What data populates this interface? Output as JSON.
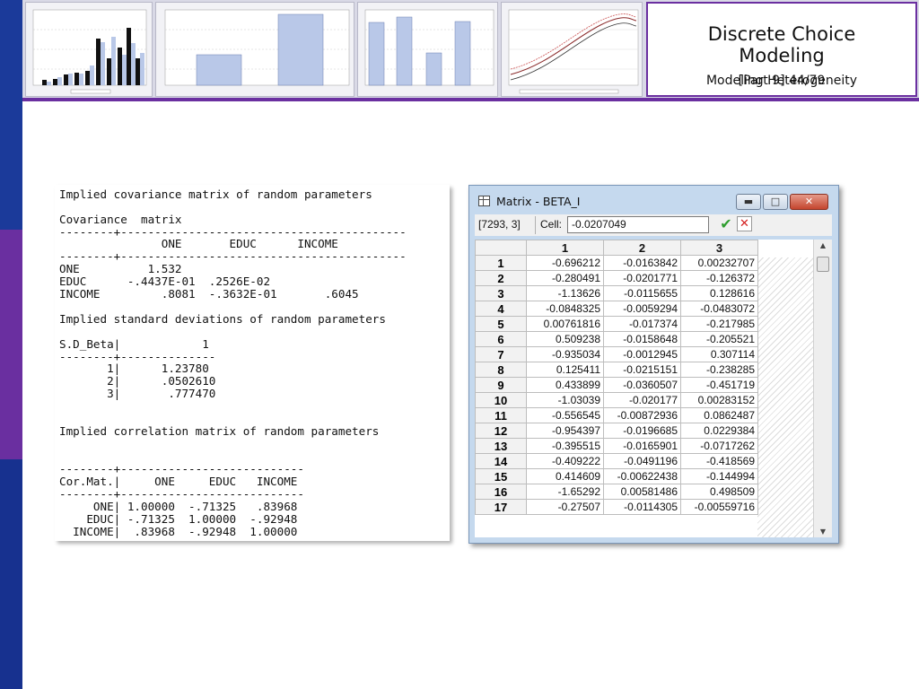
{
  "slide": {
    "title_line1": "Discrete Choice",
    "title_line2": "Modeling",
    "subtitle_left": "Modeling Heterogeneity",
    "subtitle_right": "[Part 9]    44/79"
  },
  "colors": {
    "sidebar_blue": "#1b3a9a",
    "sidebar_purple": "#6a2fa0",
    "header_bg": "#d9d9e6"
  },
  "output": {
    "heading1": "Implied covariance matrix of random parameters",
    "cov_label": "Covariance  matrix",
    "dash1": "--------+------------------------------------------",
    "cov_header": "               ONE       EDUC      INCOME",
    "dash2": "--------+------------------------------------------",
    "cov_row1": "ONE          1.532",
    "cov_row2": "EDUC      -.4437E-01  .2526E-02",
    "cov_row3": "INCOME         .8081  -.3632E-01       .6045",
    "heading2": "Implied standard deviations of random parameters",
    "sd_header": "S.D_Beta|            1",
    "dash3": "--------+--------------",
    "sd_row1": "       1|      1.23780",
    "sd_row2": "       2|      .0502610",
    "sd_row3": "       3|       .777470",
    "heading3": "Implied correlation matrix of random parameters",
    "dash4": "--------+---------------------------",
    "cor_header": "Cor.Mat.|     ONE     EDUC   INCOME",
    "dash5": "--------+---------------------------",
    "cor_row1": "     ONE| 1.00000  -.71325   .83968",
    "cor_row2": "    EDUC| -.71325  1.00000  -.92948",
    "cor_row3": "  INCOME|  .83968  -.92948  1.00000"
  },
  "matrix_window": {
    "title": "Matrix - BETA_I",
    "cell_ref": "[7293, 3]",
    "cell_label": "Cell:",
    "cell_value": "-0.0207049",
    "columns": [
      "1",
      "2",
      "3"
    ],
    "rows": [
      {
        "id": "1",
        "values": [
          "-0.696212",
          "-0.0163842",
          "0.00232707"
        ]
      },
      {
        "id": "2",
        "values": [
          "-0.280491",
          "-0.0201771",
          "-0.126372"
        ]
      },
      {
        "id": "3",
        "values": [
          "-1.13626",
          "-0.0115655",
          "0.128616"
        ]
      },
      {
        "id": "4",
        "values": [
          "-0.0848325",
          "-0.0059294",
          "-0.0483072"
        ]
      },
      {
        "id": "5",
        "values": [
          "0.00761816",
          "-0.017374",
          "-0.217985"
        ]
      },
      {
        "id": "6",
        "values": [
          "0.509238",
          "-0.0158648",
          "-0.205521"
        ]
      },
      {
        "id": "7",
        "values": [
          "-0.935034",
          "-0.0012945",
          "0.307114"
        ]
      },
      {
        "id": "8",
        "values": [
          "0.125411",
          "-0.0215151",
          "-0.238285"
        ]
      },
      {
        "id": "9",
        "values": [
          "0.433899",
          "-0.0360507",
          "-0.451719"
        ]
      },
      {
        "id": "10",
        "values": [
          "-1.03039",
          "-0.020177",
          "0.00283152"
        ]
      },
      {
        "id": "11",
        "values": [
          "-0.556545",
          "-0.00872936",
          "0.0862487"
        ]
      },
      {
        "id": "12",
        "values": [
          "-0.954397",
          "-0.0196685",
          "0.0229384"
        ]
      },
      {
        "id": "13",
        "values": [
          "-0.395515",
          "-0.0165901",
          "-0.0717262"
        ]
      },
      {
        "id": "14",
        "values": [
          "-0.409222",
          "-0.0491196",
          "-0.418569"
        ]
      },
      {
        "id": "15",
        "values": [
          "0.414609",
          "-0.00622438",
          "-0.144994"
        ]
      },
      {
        "id": "16",
        "values": [
          "-1.65292",
          "0.00581486",
          "0.498509"
        ]
      },
      {
        "id": "17",
        "values": [
          "-0.27507",
          "-0.0114305",
          "-0.00559716"
        ]
      }
    ]
  }
}
